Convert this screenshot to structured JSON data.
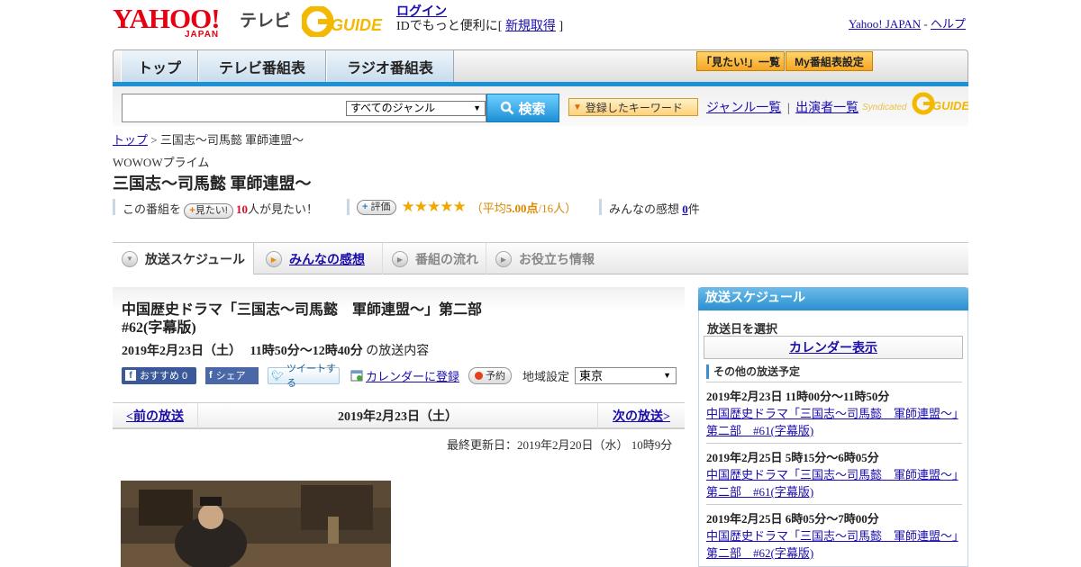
{
  "header": {
    "yahoo_logo": "YAHOO!",
    "yahoo_sub": "JAPAN",
    "tv_label": "テレビ",
    "gguide_logo": "GUIDE",
    "login_link": "ログイン",
    "signup_text": "IDでもっと便利に[",
    "signup_link": "新規取得",
    "signup_close": "]",
    "yahoo_japan_link": "Yahoo! JAPAN",
    "dash": "-",
    "help_link": "ヘルプ"
  },
  "nav": {
    "tabs": [
      "トップ",
      "テレビ番組表",
      "ラジオ番組表"
    ],
    "want_list_btn": "「見たい!」一覧",
    "my_schedule_btn": "My番組表設定"
  },
  "search": {
    "placeholder": "",
    "genre_selected": "すべてのジャンル",
    "search_btn": "検索",
    "keyword_btn": "登録したキーワード",
    "genre_list_link": "ジャンル一覧",
    "pipe": "|",
    "performer_list_link": "出演者一覧",
    "syndicated": "Syndicated"
  },
  "breadcrumb": {
    "top": "トップ",
    "sep": ">",
    "current": "三国志～司馬懿 軍師連盟～"
  },
  "program": {
    "channel": "WOWOWプライム",
    "title": "三国志～司馬懿 軍師連盟～",
    "this_program": "この番組を",
    "want_btn": "見たい!",
    "want_count": "10",
    "want_suffix": "人が見たい！",
    "rate_btn": "評価",
    "stars": "★★★★★",
    "avg_label": "（平均",
    "avg_score": "5.00点",
    "avg_count": "/16人）",
    "reviews_label": "みんなの感想",
    "reviews_count": "0",
    "reviews_suffix": "件"
  },
  "tabs": [
    "放送スケジュール",
    "みんなの感想",
    "番組の流れ",
    "お役立ち情報"
  ],
  "episode": {
    "title": "中国歴史ドラマ「三国志～司馬懿　軍師連盟～」第二部 #62(字幕版)",
    "date": "2019年2月23日（土）",
    "time": "11時50分～12時40分",
    "suffix": "の放送内容",
    "fb_recommend": "おすすめ 0",
    "fb_share": "シェア",
    "tweet": "ツイートする",
    "calendar_link": "カレンダーに登録",
    "reserve_btn": "予約",
    "region_label": "地域設定",
    "region_selected": "東京"
  },
  "pager": {
    "prev": "<前の放送",
    "current": "2019年2月23日（土）",
    "next": "次の放送>"
  },
  "updated": "最終更新日：2019年2月20日（水） 10時9分",
  "sidebar": {
    "title": "放送スケジュール",
    "select_date": "放送日を選択",
    "calendar_btn": "カレンダー表示",
    "other_heading": "その他の放送予定",
    "items": [
      {
        "when": "2019年2月23日 11時00分～11時50分",
        "link": "中国歴史ドラマ「三国志～司馬懿　軍師連盟～」第二部　#61(字幕版)"
      },
      {
        "when": "2019年2月25日 5時15分～6時05分",
        "link": "中国歴史ドラマ「三国志～司馬懿　軍師連盟～」第二部　#61(字幕版)"
      },
      {
        "when": "2019年2月25日 6時05分～7時00分",
        "link": "中国歴史ドラマ「三国志～司馬懿　軍師連盟～」第二部　#62(字幕版)"
      }
    ]
  },
  "colors": {
    "accent_blue": "#1e90d8",
    "yahoo_red": "#e60012",
    "star": "#f0a800",
    "score": "#d98a00"
  }
}
